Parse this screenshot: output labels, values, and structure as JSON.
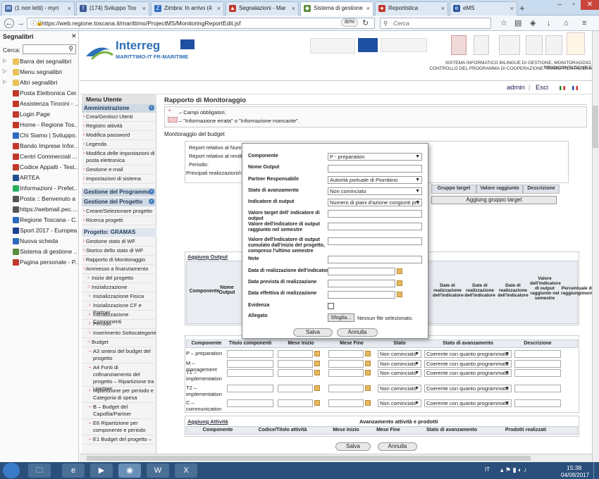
{
  "browser": {
    "tabs": [
      {
        "label": "(1 non letti) - myri",
        "icon_color": "#4a6ea9"
      },
      {
        "label": "(174) Sviluppo Tos",
        "icon_color": "#3b5998"
      },
      {
        "label": "Zimbra: In arrivo (4",
        "icon_color": "#2c6bbf"
      },
      {
        "label": "Segnalazioni - Mar",
        "icon_color": "#c0392b"
      },
      {
        "label": "Sistema di gestione",
        "icon_color": "#5b8c3a"
      },
      {
        "label": "Reportistica",
        "icon_color": "#c0392b"
      },
      {
        "label": "eMS",
        "icon_color": "#2c5aa0"
      }
    ],
    "url": "https://web.regione.toscana.it/marittimo/ProjectMS/MonitoringReportEdit.jsf",
    "zoom": "80%",
    "search_placeholder": "Cerca"
  },
  "bookmarks": {
    "title": "Segnalibri",
    "search_label": "Cerca:",
    "items": [
      {
        "label": "Barra dei segnalibri",
        "color": "#e8c35a",
        "folder": true
      },
      {
        "label": "Menu segnalibri",
        "color": "#e8c35a",
        "folder": true
      },
      {
        "label": "Altri segnalibri",
        "color": "#e8c35a",
        "folder": true
      },
      {
        "label": "Posta Elettronica Cer...",
        "color": "#c0392b"
      },
      {
        "label": "Assistenza Tirocini - ...",
        "color": "#c0392b"
      },
      {
        "label": "Login Page",
        "color": "#c0392b"
      },
      {
        "label": "Home - Regione Tos...",
        "color": "#c0392b"
      },
      {
        "label": "Chi Siamo | Sviluppo...",
        "color": "#2c6bbf"
      },
      {
        "label": "Bando Imprese Infor...",
        "color": "#c0392b"
      },
      {
        "label": "Centri Commerciali ...",
        "color": "#c0392b"
      },
      {
        "label": "Codice Appalti - Test...",
        "color": "#c0392b"
      },
      {
        "label": "ARTEA",
        "color": "#1f4f8f"
      },
      {
        "label": "Informazioni - Prefet...",
        "color": "#27ae60"
      },
      {
        "label": "Posta :: Benvenuto a ...",
        "color": "#555555"
      },
      {
        "label": "https://webmail.pec....",
        "color": "#555555"
      },
      {
        "label": "Regione Toscana - C...",
        "color": "#2c6bbf"
      },
      {
        "label": "Sport 2017 - Europea...",
        "color": "#1f3f8f"
      },
      {
        "label": "Nuova scheda",
        "color": "#2c6bbf"
      },
      {
        "label": "Sistema di gestione ...",
        "color": "#5b8c3a"
      },
      {
        "label": "Pagina personale - P...",
        "color": "#c0392b"
      }
    ]
  },
  "header": {
    "logo_title": "Interreg",
    "logo_subtitle": "MARITTIMO-IT FR-MARITIME",
    "line1": "SISTEMA INFORMATICO BILINGUE DI GESTIONE, MONITORAGGIO, RENDICONTAZIONE E",
    "line2": "CONTROLLO DEL PROGRAMMA DI COOPERAZIONE TRANSFRONTALIERA",
    "user": "admin",
    "logout": "Esci"
  },
  "menu": {
    "title": "Menu Utente",
    "sec_admin": "Amministrazione",
    "admin_items": [
      "Crea/Gestisci Utenti",
      "Registro attività",
      "Modifica password",
      "Legenda",
      "Modifica delle impostazioni di posta elettronica",
      "Gestione e-mail",
      "Impostazioni di sistema"
    ],
    "sec_programma": "Gestione del Programma",
    "sec_progetto": "Gestione del Progetto",
    "progetto_items": [
      "Creare/Selezionare progetto",
      "Ricerca progetti"
    ],
    "progetto_label": "Progetto: GRAMAS",
    "gramas_items": [
      "Gestione stato di WF",
      "Storico dello stato di WF",
      "Rapporto di Monitoraggio",
      "Ammesso a finanziamento",
      "Inizio del progetto",
      "Inizializzazione",
      "Inizializzazione Fisica",
      "Inizializzazione CF e Partner",
      "Inizializzazione Componenti",
      "Periodo",
      "Inserimento Sottocategorie",
      "Budget",
      "A3 sintesi del budget del progetto",
      "A4 Fonti di cofinanziamento del progetto – Ripartizione tra i partner",
      "Ripartizione per periodo e Categoria di spesa",
      "B – Budget del Capofila/Partner",
      "E6 Ripartizione per componente e periodo",
      "E1 Budget del progetto –"
    ]
  },
  "page": {
    "title": "Rapporto di Monitoraggio",
    "legend_required": "– Campi obbligatori.",
    "legend_error": "– \"Informazione errata\" o \"Informazione mancante\".",
    "budget_label": "Monitoraggio del budget",
    "report_line1": "Report relativo al Nume",
    "report_line2": "Report relativo al rendic",
    "periodo": "Periodo:",
    "principali": "Principali realizzazioni/ri",
    "group_headers": [
      "Gruppo target",
      "Valore raggiunto",
      "Descrizione"
    ],
    "add_group_btn": "Aggiung gruppo target",
    "add_output_link": "Aggiung Output",
    "output_headers": [
      "Componente",
      "Nome Output",
      "Date di realizzazione dell'indicatore",
      "Date di realizzazione dell'indicatore",
      "Date di realizzazione dell'indicatore",
      "Valore dell'indicatore di output raggiunto nel semestre",
      "Percentuale di raggiungimento"
    ],
    "comp_headers": [
      "Componente",
      "Titolo componenti",
      "Mese Inizio",
      "Mese Fine",
      "Stato",
      "Stato di avanzamento",
      "Descrizione"
    ],
    "comp_rows": [
      {
        "name": "P – preparation",
        "stato": "Non cominciato",
        "avanz": "Coerente con quanto programmato"
      },
      {
        "name": "M – management",
        "stato": "Non cominciato",
        "avanz": "Coerente con quanto programmato"
      },
      {
        "name": "T1 – implementation",
        "stato": "Non cominciato",
        "avanz": "Coerente con quanto programmato"
      },
      {
        "name": "T2 – implementation",
        "stato": "Non cominciato",
        "avanz": "Coerente con quanto programmato"
      },
      {
        "name": "C – communication",
        "stato": "Non cominciato",
        "avanz": "Coerente con quanto programmato"
      }
    ],
    "act_link": "Aggiung Attività",
    "act_title": "Avanzamento attività e prodotti",
    "act_headers": [
      "Componente",
      "Codice/Titolo attività",
      "Mese Inizio",
      "Mese Fine",
      "Stato di avanzamento",
      "Prodotti realizzati"
    ],
    "save": "Salva",
    "cancel": "Annulla"
  },
  "modal": {
    "componente_label": "Componente",
    "componente_value": "P - preparation",
    "nome_output_label": "Nome Output",
    "partner_label": "Partner Responsabile",
    "partner_value": "Autorità portuale di Piombino",
    "stato_label": "Stato di avanzamento",
    "stato_value": "Non cominciato",
    "indicatore_label": "Indicatore di output",
    "indicatore_value": "Numero di piani d'azione congiunti pre",
    "target_label": "Valore target dell' indicatore di output",
    "raggiunto_label": "Valore dell'indicatore di output raggiunto nel semestre",
    "cumulato_label": "Valore dell'indicatore di output cumulato dall'inizio del progetto, compreso l'ultimo semestre",
    "note_label": "Note",
    "data_real_label": "Data di realizzazione dell'indicatore",
    "data_prev_label": "Data prevista di realizzazione",
    "data_eff_label": "Data effettiva di realizzazione",
    "evidenza_label": "Evidenza",
    "allegato_label": "Allegato",
    "browse": "Sfoglia...",
    "no_file": "Nessun file selezionato.",
    "save": "Salva",
    "cancel": "Annulla"
  },
  "taskbar": {
    "lang": "IT",
    "time": "15:38",
    "date": "04/08/2017"
  }
}
